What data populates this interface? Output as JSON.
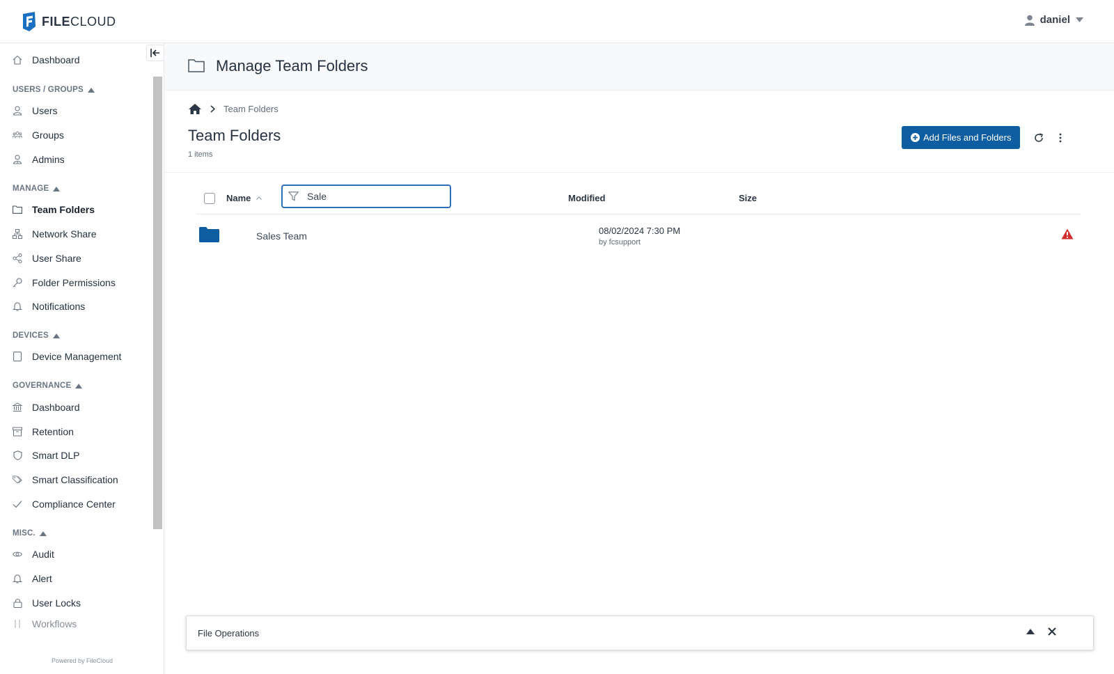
{
  "app": {
    "logo_text_bold": "FILE",
    "logo_text_rest": "CLOUD",
    "user_name": "daniel"
  },
  "sidebar": {
    "dashboard": "Dashboard",
    "sections": {
      "users_groups": "USERS / GROUPS",
      "manage": "MANAGE",
      "devices": "DEVICES",
      "governance": "GOVERNANCE",
      "misc": "MISC."
    },
    "items": {
      "users": "Users",
      "groups": "Groups",
      "admins": "Admins",
      "team_folders": "Team Folders",
      "network_share": "Network Share",
      "user_share": "User Share",
      "folder_permissions": "Folder Permissions",
      "notifications": "Notifications",
      "device_management": "Device Management",
      "gov_dashboard": "Dashboard",
      "retention": "Retention",
      "smart_dlp": "Smart DLP",
      "smart_classification": "Smart Classification",
      "compliance_center": "Compliance Center",
      "audit": "Audit",
      "alert": "Alert",
      "user_locks": "User Locks",
      "workflows": "Workflows"
    },
    "powered_by": "Powered by FileCloud"
  },
  "main": {
    "page_title": "Manage Team Folders",
    "breadcrumb_current": "Team Folders",
    "section_title": "Team Folders",
    "items_count": "1 items",
    "add_button": "Add Files and Folders",
    "columns": {
      "name": "Name",
      "modified": "Modified",
      "size": "Size"
    },
    "filter_value": "Sale",
    "rows": [
      {
        "name": "Sales Team",
        "modified": "08/02/2024 7:30 PM",
        "modified_by": "by fcsupport",
        "size": ""
      }
    ],
    "file_operations": "File Operations"
  },
  "colors": {
    "accent": "#0d5da3",
    "warning": "#d32f2f",
    "folder": "#0d5da3"
  }
}
